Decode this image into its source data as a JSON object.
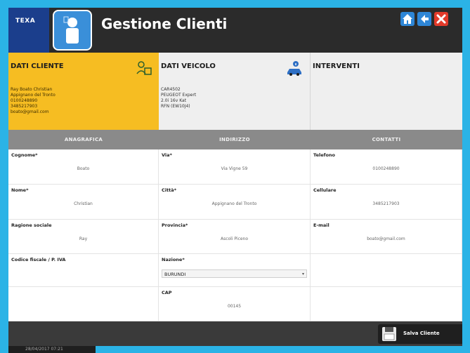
{
  "app": {
    "brand": "TEXA",
    "title": "Gestione Clienti"
  },
  "toolbar": {
    "home_icon": "home-icon",
    "back_icon": "back-arrow-icon",
    "close_icon": "close-icon"
  },
  "summary": {
    "client": {
      "title": "DATI CLIENTE",
      "lines": [
        "Ray Boato Christian",
        "Appignano del Tronto",
        "0100248890",
        "3485217903",
        "boato@gmail.com"
      ]
    },
    "vehicle": {
      "title": "DATI VEICOLO",
      "lines": [
        "CAR4502",
        "PEUGEOT Expert",
        "2.0i 16v Kat",
        "RFN (EW10J4)"
      ]
    },
    "interventions": {
      "title": "INTERVENTI"
    }
  },
  "columns": [
    "ANAGRAFICA",
    "INDIRIZZO",
    "CONTATTI"
  ],
  "form": {
    "cognome": {
      "label": "Cognome*",
      "value": "Boato"
    },
    "nome": {
      "label": "Nome*",
      "value": "Christian"
    },
    "ragione_sociale": {
      "label": "Ragione sociale",
      "value": "Ray"
    },
    "codice_fiscale": {
      "label": "Codice fiscale / P. IVA",
      "value": ""
    },
    "via": {
      "label": "Via*",
      "value": "Via Vigne 59"
    },
    "citta": {
      "label": "Città*",
      "value": "Appignano del Tronto"
    },
    "provincia": {
      "label": "Provincia*",
      "value": "Ascoli Piceno"
    },
    "nazione": {
      "label": "Nazione*",
      "value": "BURUNDI"
    },
    "cap": {
      "label": "CAP",
      "value": "00145"
    },
    "telefono": {
      "label": "Telefono",
      "value": "0100248890"
    },
    "cellulare": {
      "label": "Cellulare",
      "value": "3485217903"
    },
    "email": {
      "label": "E-mail",
      "value": "boato@gmail.com"
    }
  },
  "footer": {
    "save_label": "Salva Cliente",
    "datetime": "28/04/2017 07:21"
  },
  "colors": {
    "accent": "#f6bd22",
    "background": "#2bb3e6",
    "topbar": "#2b2b2b",
    "header": "#8a8a8a"
  }
}
